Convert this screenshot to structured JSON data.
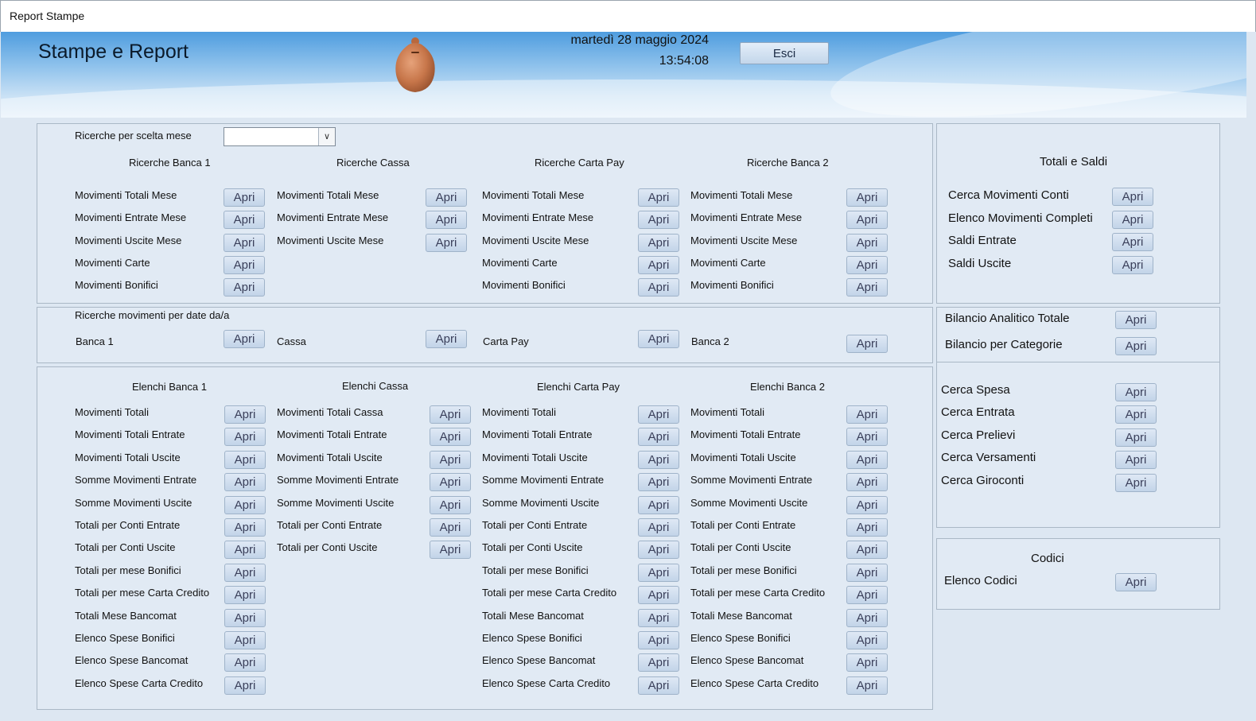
{
  "window": {
    "title": "Report Stampe"
  },
  "header": {
    "title": "Stampe e Report",
    "date": "martedì 28 maggio 2024",
    "time": "13:54:08",
    "exit_label": "Esci"
  },
  "open_label": "Apri",
  "month_search": {
    "label": "Ricerche per scelta mese",
    "value": "",
    "columns": {
      "banca1": {
        "title": "Ricerche Banca 1",
        "items": [
          "Movimenti Totali Mese",
          "Movimenti Entrate Mese",
          "Movimenti Uscite Mese",
          "Movimenti Carte",
          "Movimenti Bonifici"
        ]
      },
      "cassa": {
        "title": "Ricerche Cassa",
        "items": [
          "Movimenti Totali Mese",
          "Movimenti Entrate Mese",
          "Movimenti Uscite Mese"
        ]
      },
      "cartapay": {
        "title": "Ricerche Carta Pay",
        "items": [
          "Movimenti Totali Mese",
          "Movimenti Entrate Mese",
          "Movimenti Uscite Mese",
          "Movimenti Carte",
          "Movimenti Bonifici"
        ]
      },
      "banca2": {
        "title": "Ricerche Banca 2",
        "items": [
          "Movimenti Totali Mese",
          "Movimenti Entrate Mese",
          "Movimenti Uscite Mese",
          "Movimenti Carte",
          "Movimenti Bonifici"
        ]
      }
    }
  },
  "date_search": {
    "label": "Ricerche movimenti per date da/a",
    "items": [
      "Banca 1",
      "Cassa",
      "Carta Pay",
      "Banca 2"
    ]
  },
  "lists": {
    "banca1": {
      "title": "Elenchi Banca 1",
      "items": [
        "Movimenti Totali",
        "Movimenti Totali Entrate",
        "Movimenti Totali Uscite",
        "Somme Movimenti Entrate",
        "Somme Movimenti Uscite",
        "Totali per Conti Entrate",
        "Totali per Conti Uscite",
        "Totali per mese Bonifici",
        "Totali per mese Carta Credito",
        "Totali Mese Bancomat",
        "Elenco Spese Bonifici",
        "Elenco Spese Bancomat",
        "Elenco Spese Carta Credito"
      ]
    },
    "cassa": {
      "title": "Elenchi Cassa",
      "items": [
        "Movimenti Totali Cassa",
        "Movimenti Totali Entrate",
        "Movimenti Totali Uscite",
        "Somme Movimenti Entrate",
        "Somme Movimenti Uscite",
        "Totali per Conti Entrate",
        "Totali per Conti Uscite"
      ]
    },
    "cartapay": {
      "title": "Elenchi Carta Pay",
      "items": [
        "Movimenti Totali",
        "Movimenti Totali Entrate",
        "Movimenti Totali Uscite",
        "Somme Movimenti Entrate",
        "Somme Movimenti Uscite",
        "Totali per Conti Entrate",
        "Totali per Conti Uscite",
        "Totali per mese Bonifici",
        "Totali per mese Carta Credito",
        "Totali Mese Bancomat",
        "Elenco Spese Bonifici",
        "Elenco Spese Bancomat",
        "Elenco Spese Carta Credito"
      ]
    },
    "banca2": {
      "title": "Elenchi Banca 2",
      "items": [
        "Movimenti Totali",
        "Movimenti Totali Entrate",
        "Movimenti Totali Uscite",
        "Somme Movimenti Entrate",
        "Somme Movimenti Uscite",
        "Totali per Conti Entrate",
        "Totali per Conti Uscite",
        "Totali per mese Bonifici",
        "Totali per mese Carta Credito",
        "Totali Mese Bancomat",
        "Elenco Spese Bonifici",
        "Elenco Spese Bancomat",
        "Elenco Spese Carta Credito"
      ]
    }
  },
  "totals": {
    "title": "Totali e Saldi",
    "items": [
      "Cerca Movimenti Conti",
      "Elenco Movimenti Completi",
      "Saldi Entrate",
      "Saldi Uscite"
    ]
  },
  "balance": {
    "items": [
      "Bilancio Analitico Totale",
      "Bilancio per Categorie"
    ]
  },
  "search": {
    "items": [
      "Cerca Spesa",
      "Cerca Entrata",
      "Cerca Prelievi",
      "Cerca Versamenti",
      "Cerca Giroconti"
    ]
  },
  "codes": {
    "title": "Codici",
    "items": [
      "Elenco Codici"
    ]
  }
}
